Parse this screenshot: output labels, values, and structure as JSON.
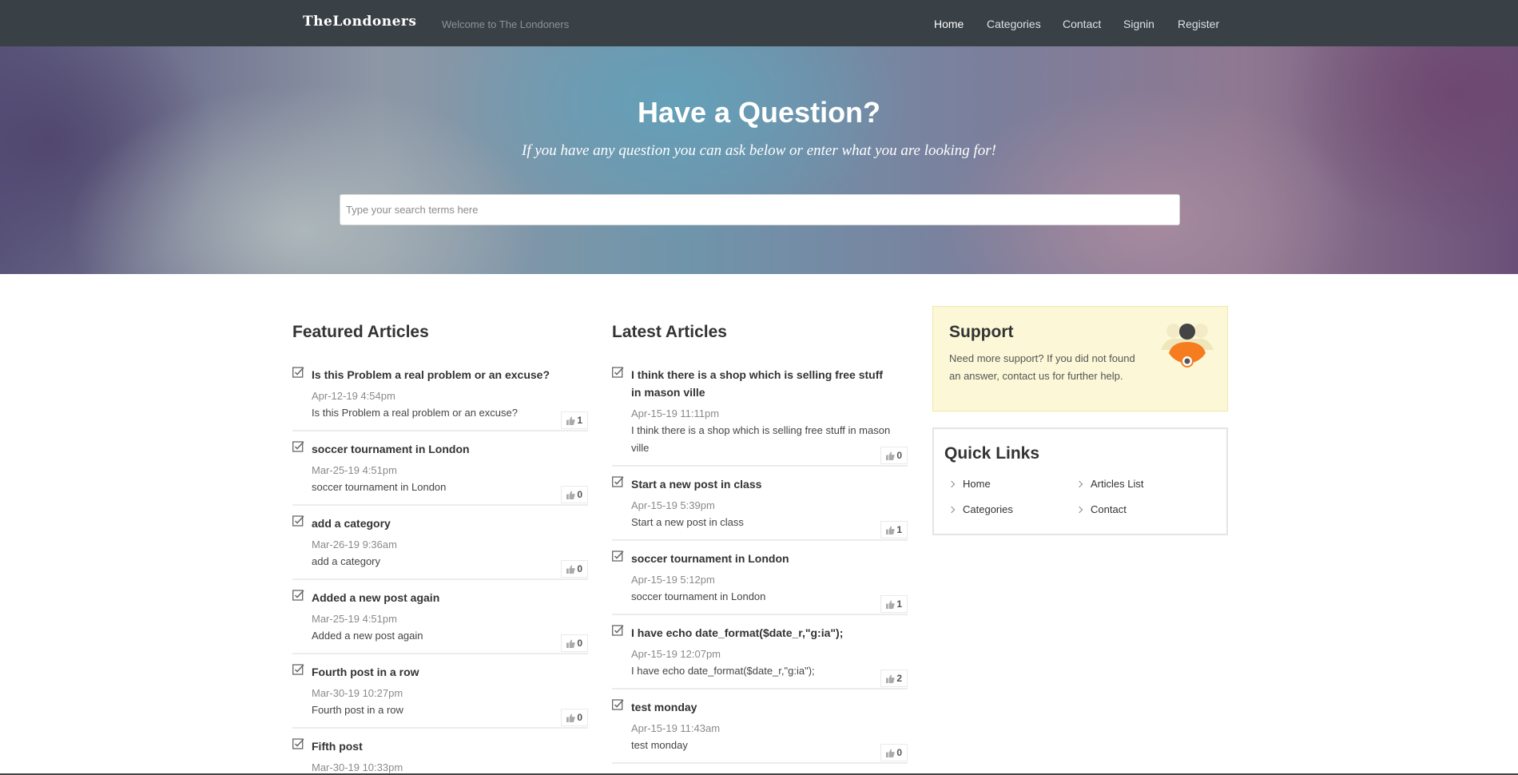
{
  "brand": {
    "logo": "TheLondoners",
    "tagline": "Welcome to The Londoners"
  },
  "nav": {
    "items": [
      {
        "label": "Home",
        "active": true
      },
      {
        "label": "Categories",
        "active": false
      },
      {
        "label": "Contact",
        "active": false
      },
      {
        "label": "Signin",
        "active": false
      },
      {
        "label": "Register",
        "active": false
      }
    ]
  },
  "hero": {
    "title": "Have a Question?",
    "subtitle": "If you have any question you can ask below or enter what you are looking for!",
    "search_placeholder": "Type your search terms here"
  },
  "featured": {
    "title": "Featured Articles",
    "articles": [
      {
        "title": "Is this Problem a real problem or an excuse?",
        "date": "Apr-12-19 4:54pm",
        "excerpt": "Is this Problem a real problem or an excuse?",
        "likes": "1"
      },
      {
        "title": "soccer tournament in London",
        "date": "Mar-25-19 4:51pm",
        "excerpt": "soccer tournament in London",
        "likes": "0"
      },
      {
        "title": "add a category",
        "date": "Mar-26-19 9:36am",
        "excerpt": "add a category",
        "likes": "0"
      },
      {
        "title": "Added a new post again",
        "date": "Mar-25-19 4:51pm",
        "excerpt": "Added a new post again",
        "likes": "0"
      },
      {
        "title": "Fourth post in a row",
        "date": "Mar-30-19 10:27pm",
        "excerpt": "Fourth post in a row",
        "likes": "0"
      },
      {
        "title": "Fifth post",
        "date": "Mar-30-19 10:33pm",
        "excerpt": "",
        "likes": ""
      }
    ]
  },
  "latest": {
    "title": "Latest Articles",
    "articles": [
      {
        "title": "I think there is a shop which is selling free stuff in mason ville",
        "date": "Apr-15-19 11:11pm",
        "excerpt": "I think there is a shop which is selling free stuff in mason ville",
        "likes": "0"
      },
      {
        "title": "Start a new post in class",
        "date": "Apr-15-19 5:39pm",
        "excerpt": "Start a new post in class",
        "likes": "1"
      },
      {
        "title": "soccer tournament in London",
        "date": "Apr-15-19 5:12pm",
        "excerpt": "soccer tournament in London",
        "likes": "1"
      },
      {
        "title": "I have echo date_format($date_r,\"g:ia\");",
        "date": "Apr-15-19 12:07pm",
        "excerpt": "I have echo date_format($date_r,\"g:ia\");",
        "likes": "2"
      },
      {
        "title": "test monday",
        "date": "Apr-15-19 11:43am",
        "excerpt": "test monday",
        "likes": "0"
      }
    ]
  },
  "support": {
    "title": "Support",
    "text": "Need more support? If you did not found an answer, contact us for further help."
  },
  "quick_links": {
    "title": "Quick Links",
    "items": [
      "Home",
      "Articles List",
      "Categories",
      "Contact"
    ]
  }
}
